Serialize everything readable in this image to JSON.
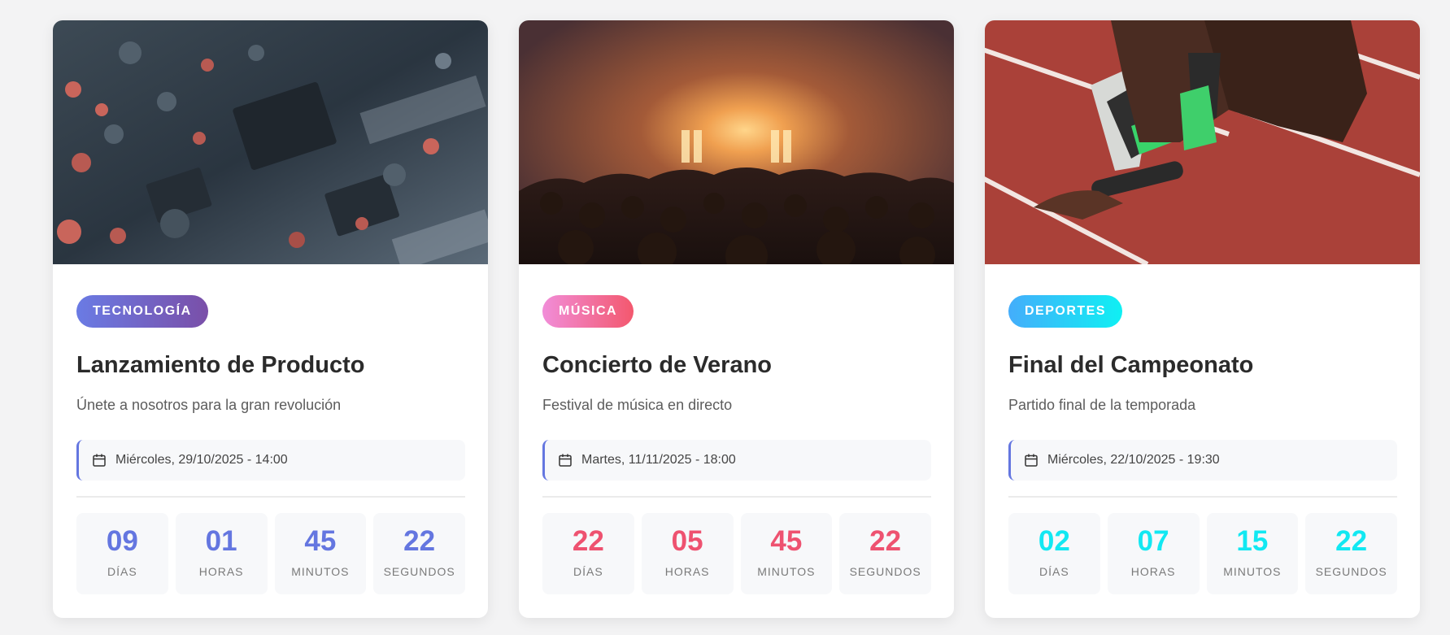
{
  "events": [
    {
      "category": "Tecnología",
      "title": "Lanzamiento de Producto",
      "description": "Únete a nosotros para la gran revolución",
      "date": "Miércoles, 29/10/2025 - 14:00",
      "accent": "#6476e0",
      "badge_gradient": [
        "#6a7be4",
        "#7a4fa8"
      ],
      "countdown": {
        "days": "09",
        "hours": "01",
        "minutes": "45",
        "seconds": "22"
      }
    },
    {
      "category": "Música",
      "title": "Concierto de Verano",
      "description": "Festival de música en directo",
      "date": "Martes, 11/11/2025 - 18:00",
      "accent": "#ee5270",
      "badge_gradient": [
        "#f18dd8",
        "#f3586e"
      ],
      "countdown": {
        "days": "22",
        "hours": "05",
        "minutes": "45",
        "seconds": "22"
      }
    },
    {
      "category": "Deportes",
      "title": "Final del Campeonato",
      "description": "Partido final de la temporada",
      "date": "Miércoles, 22/10/2025 - 19:30",
      "accent": "#12e8f2",
      "badge_gradient": [
        "#44adfb",
        "#0ff0f3"
      ],
      "countdown": {
        "days": "02",
        "hours": "07",
        "minutes": "15",
        "seconds": "22"
      }
    }
  ],
  "labels": {
    "days": "Días",
    "hours": "Horas",
    "minutes": "Minutos",
    "seconds": "Segundos"
  },
  "icons": {
    "date": "calendar-icon"
  }
}
